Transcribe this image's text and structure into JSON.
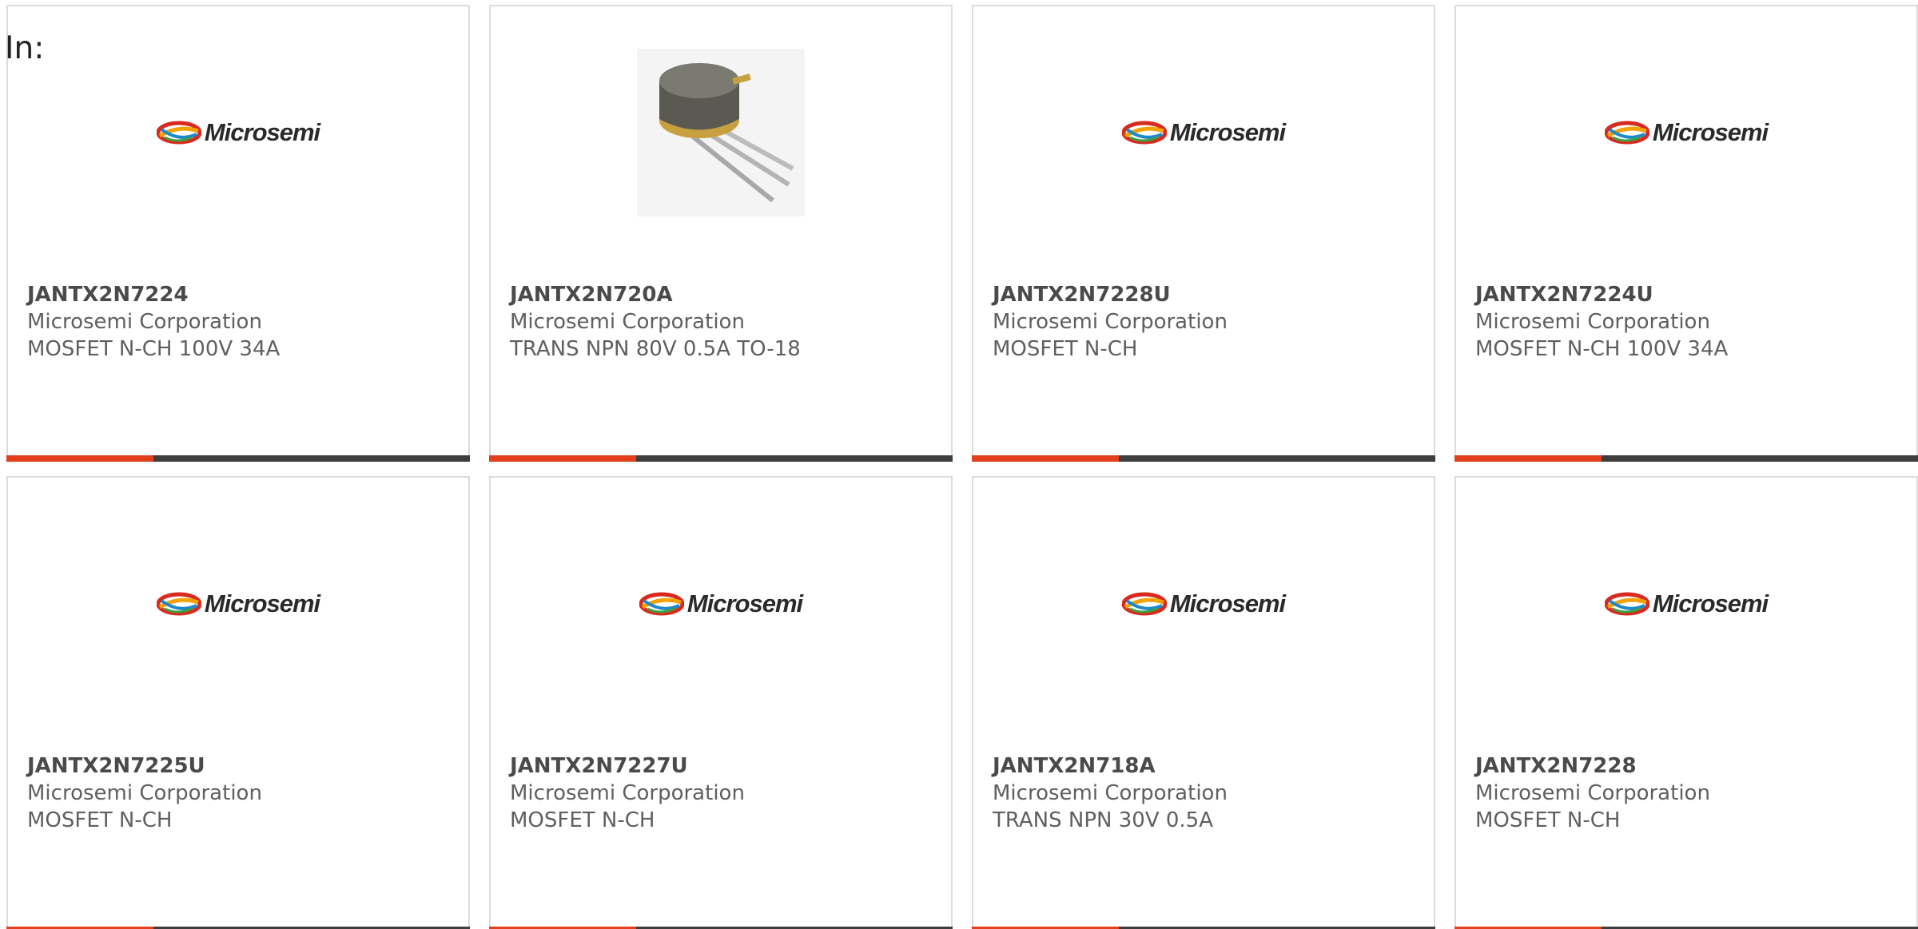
{
  "header": {
    "in_label": "In:"
  },
  "brand": {
    "logo_text": "Microsemi",
    "accent_color": "#e2401c",
    "bar_color": "#3d3d3d"
  },
  "products": [
    {
      "part": "JANTX2N7224",
      "manufacturer": "Microsemi Corporation",
      "description": "MOSFET N-CH 100V 34A",
      "image": "microsemi-logo"
    },
    {
      "part": "JANTX2N720A",
      "manufacturer": "Microsemi Corporation",
      "description": "TRANS NPN 80V 0.5A TO-18",
      "image": "to18-transistor-photo"
    },
    {
      "part": "JANTX2N7228U",
      "manufacturer": "Microsemi Corporation",
      "description": "MOSFET N-CH",
      "image": "microsemi-logo"
    },
    {
      "part": "JANTX2N7224U",
      "manufacturer": "Microsemi Corporation",
      "description": "MOSFET N-CH 100V 34A",
      "image": "microsemi-logo"
    },
    {
      "part": "JANTX2N7225U",
      "manufacturer": "Microsemi Corporation",
      "description": "MOSFET N-CH",
      "image": "microsemi-logo"
    },
    {
      "part": "JANTX2N7227U",
      "manufacturer": "Microsemi Corporation",
      "description": "MOSFET N-CH",
      "image": "microsemi-logo"
    },
    {
      "part": "JANTX2N718A",
      "manufacturer": "Microsemi Corporation",
      "description": "TRANS NPN 30V 0.5A",
      "image": "microsemi-logo"
    },
    {
      "part": "JANTX2N7228",
      "manufacturer": "Microsemi Corporation",
      "description": "MOSFET N-CH",
      "image": "microsemi-logo"
    }
  ]
}
